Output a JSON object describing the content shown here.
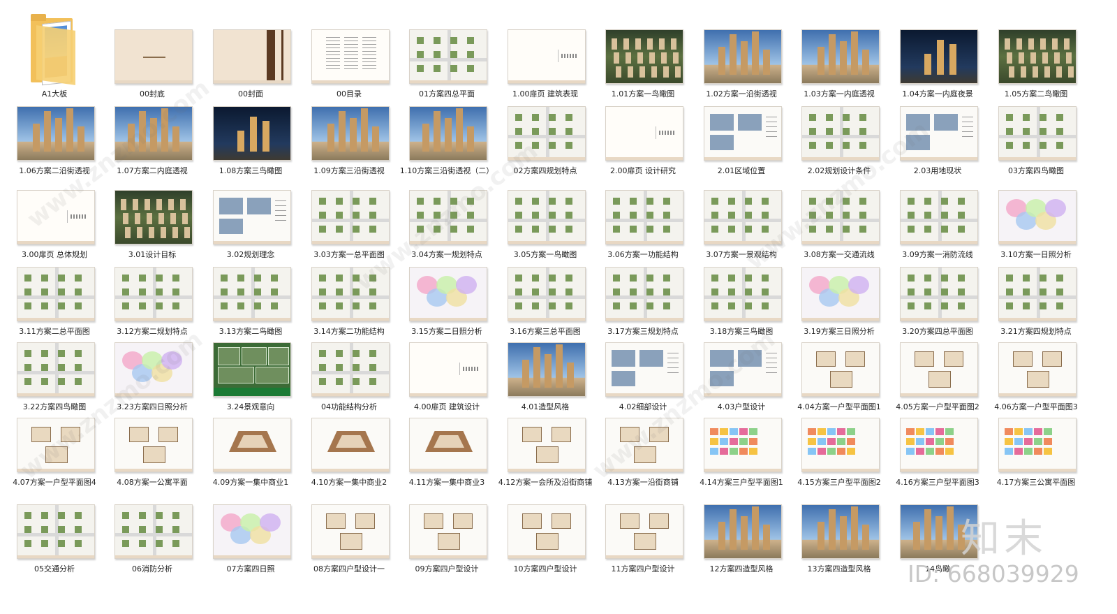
{
  "items": [
    {
      "label": "A1大板",
      "kind": "folder"
    },
    {
      "label": "00封底",
      "kind": "cover"
    },
    {
      "label": "00封面",
      "kind": "coverbar"
    },
    {
      "label": "00目录",
      "kind": "text"
    },
    {
      "label": "01方案四总平面",
      "kind": "plan"
    },
    {
      "label": "1.00扉页 建筑表现",
      "kind": "blank"
    },
    {
      "label": "1.01方案一鸟瞰图",
      "kind": "aerial"
    },
    {
      "label": "1.02方案一沿街透视",
      "kind": "photo"
    },
    {
      "label": "1.03方案一内庭透视",
      "kind": "photo"
    },
    {
      "label": "1.04方案一内庭夜景",
      "kind": "night"
    },
    {
      "label": "1.05方案二鸟瞰图",
      "kind": "aerial"
    },
    {
      "label": "1.06方案二沿街透视",
      "kind": "photo"
    },
    {
      "label": "1.07方案二内庭透视",
      "kind": "photo"
    },
    {
      "label": "1.08方案三鸟瞰图",
      "kind": "night"
    },
    {
      "label": "1.09方案三沿街透视",
      "kind": "photo"
    },
    {
      "label": "1.10方案三沿街透视（二）",
      "kind": "photo"
    },
    {
      "label": "02方案四规划特点",
      "kind": "plan"
    },
    {
      "label": "2.00扉页 设计研究",
      "kind": "blank"
    },
    {
      "label": "2.01区域位置",
      "kind": "mix"
    },
    {
      "label": "2.02规划设计条件",
      "kind": "plan"
    },
    {
      "label": "2.03用地现状",
      "kind": "mix"
    },
    {
      "label": "03方案四鸟瞰图",
      "kind": "plan"
    },
    {
      "label": "3.00扉页 总体规划",
      "kind": "blank"
    },
    {
      "label": "3.01设计目标",
      "kind": "aerial"
    },
    {
      "label": "3.02规划理念",
      "kind": "mix"
    },
    {
      "label": "3.03方案一总平面图",
      "kind": "plan"
    },
    {
      "label": "3.04方案一规划特点",
      "kind": "plan"
    },
    {
      "label": "3.05方案一鸟瞰图",
      "kind": "plan"
    },
    {
      "label": "3.06方案一功能结构",
      "kind": "plan"
    },
    {
      "label": "3.07方案一景观结构",
      "kind": "plan"
    },
    {
      "label": "3.08方案一交通流线",
      "kind": "plan"
    },
    {
      "label": "3.09方案一消防流线",
      "kind": "plan"
    },
    {
      "label": "3.10方案一日照分析",
      "kind": "sun"
    },
    {
      "label": "3.11方案二总平面图",
      "kind": "plan"
    },
    {
      "label": "3.12方案二规划特点",
      "kind": "plan"
    },
    {
      "label": "3.13方案二鸟瞰图",
      "kind": "plan"
    },
    {
      "label": "3.14方案二功能结构",
      "kind": "plan"
    },
    {
      "label": "3.15方案二日照分析",
      "kind": "sun"
    },
    {
      "label": "3.16方案三总平面图",
      "kind": "plan"
    },
    {
      "label": "3.17方案三规划特点",
      "kind": "plan"
    },
    {
      "label": "3.18方案三鸟瞰图",
      "kind": "plan"
    },
    {
      "label": "3.19方案三日照分析",
      "kind": "sun"
    },
    {
      "label": "3.20方案四总平面图",
      "kind": "plan"
    },
    {
      "label": "3.21方案四规划特点",
      "kind": "plan"
    },
    {
      "label": "3.22方案四鸟瞰图",
      "kind": "plan"
    },
    {
      "label": "3.23方案四日照分析",
      "kind": "sun"
    },
    {
      "label": "3.24景观意向",
      "kind": "green"
    },
    {
      "label": "04功能结构分析",
      "kind": "plan"
    },
    {
      "label": "4.00扉页 建筑设计",
      "kind": "blank"
    },
    {
      "label": "4.01造型风格",
      "kind": "photo"
    },
    {
      "label": "4.02细部设计",
      "kind": "mix"
    },
    {
      "label": "4.03户型设计",
      "kind": "mix"
    },
    {
      "label": "4.04方案一户型平面图1",
      "kind": "floor"
    },
    {
      "label": "4.05方案一户型平面图2",
      "kind": "floor"
    },
    {
      "label": "4.06方案一户型平面图3",
      "kind": "floor"
    },
    {
      "label": "4.07方案一户型平面图4",
      "kind": "floor"
    },
    {
      "label": "4.08方案一公寓平面",
      "kind": "floor"
    },
    {
      "label": "4.09方案一集中商业1",
      "kind": "fan"
    },
    {
      "label": "4.10方案一集中商业2",
      "kind": "fan"
    },
    {
      "label": "4.11方案一集中商业3",
      "kind": "fan"
    },
    {
      "label": "4.12方案一会所及沿街商铺",
      "kind": "floor"
    },
    {
      "label": "4.13方案一沿街商铺",
      "kind": "floor"
    },
    {
      "label": "4.14方案三户型平面图1",
      "kind": "color"
    },
    {
      "label": "4.15方案三户型平面图2",
      "kind": "color"
    },
    {
      "label": "4.16方案三户型平面图3",
      "kind": "color"
    },
    {
      "label": "4.17方案三公寓平面图",
      "kind": "color"
    },
    {
      "label": "05交通分析",
      "kind": "plan"
    },
    {
      "label": "06消防分析",
      "kind": "plan"
    },
    {
      "label": "07方案四日照",
      "kind": "sun"
    },
    {
      "label": "08方案四户型设计一",
      "kind": "floor"
    },
    {
      "label": "09方案四户型设计",
      "kind": "floor"
    },
    {
      "label": "10方案四户型设计",
      "kind": "floor"
    },
    {
      "label": "11方案四户型设计",
      "kind": "floor"
    },
    {
      "label": "12方案四造型风格",
      "kind": "photo"
    },
    {
      "label": "13方案四造型风格",
      "kind": "photo"
    },
    {
      "label": "14鸟瞰",
      "kind": "photo"
    }
  ],
  "watermark": {
    "logo": "知末",
    "id": "ID: 668039929",
    "site": "www.znzmo.com"
  },
  "colors": {
    "thumb_border": "#d9d2c8",
    "cover": "#f1e3d1",
    "label": "#222222"
  }
}
